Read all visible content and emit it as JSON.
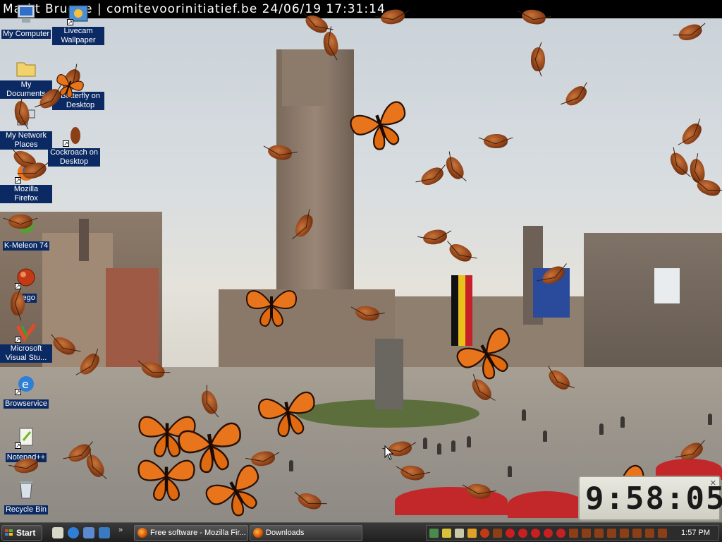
{
  "banner": {
    "text": "Markt Brugge | comitevoorinitiatief.be 24/06/19 17:31:14"
  },
  "desktop_icons": [
    {
      "label": "My Computer",
      "icon": "computer-icon"
    },
    {
      "label": "Livecam Wallpaper",
      "icon": "livecam-icon"
    },
    {
      "label": "My Documents",
      "icon": "folder-icon"
    },
    {
      "label": "Butterfly on Desktop",
      "icon": "butterfly-app-icon"
    },
    {
      "label": "My Network Places",
      "icon": "network-icon"
    },
    {
      "label": "Cockroach on Desktop",
      "icon": "cockroach-app-icon"
    },
    {
      "label": "Mozilla Firefox",
      "icon": "firefox-icon"
    },
    {
      "label": "K-Meleon 74",
      "icon": "kmeleon-icon"
    },
    {
      "label": "Pego",
      "icon": "pego-icon"
    },
    {
      "label": "Microsoft Visual Stu...",
      "icon": "visual-studio-icon"
    },
    {
      "label": "Browservice",
      "icon": "ie-icon"
    },
    {
      "label": "Notepad++",
      "icon": "notepad-icon"
    },
    {
      "label": "Recycle Bin",
      "icon": "recycle-bin-icon"
    }
  ],
  "clock": {
    "time": "9:58:05"
  },
  "taskbar": {
    "start_label": "Start",
    "quick_launch": [
      "show-desktop-icon",
      "ie-icon",
      "outlook-icon",
      "media-player-icon"
    ],
    "overflow": "»",
    "tasks": [
      {
        "label": "Free software - Mozilla Fir...",
        "icon": "firefox-icon"
      },
      {
        "label": "Downloads",
        "icon": "firefox-icon"
      }
    ],
    "tray_time": "1:57 PM"
  },
  "colors": {
    "banner_bg": "#000000",
    "icon_label_bg": "#0b2a63",
    "taskbar_bg": "#2a2a2a",
    "butterfly_orange": "#e8741c",
    "roach_brown": "#8a3f16"
  }
}
